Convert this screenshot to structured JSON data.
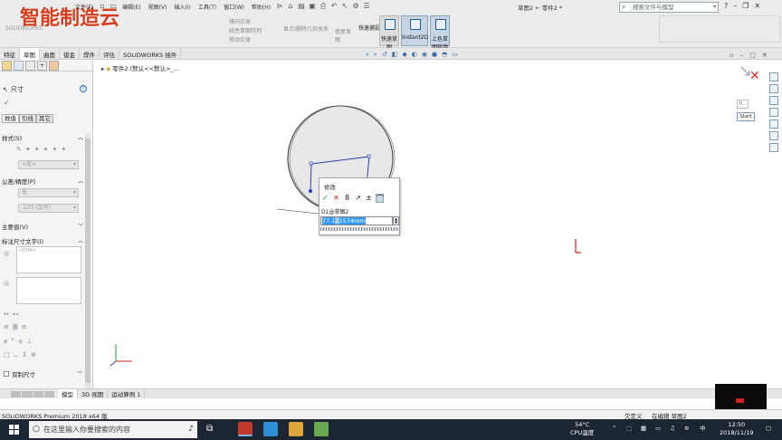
{
  "app": {
    "logo_text": "智能制造云",
    "logo_sub": "SOLIDWORKS",
    "doc_title": "草图2 ← 零件2 *",
    "search_placeholder": "搜索文件与模型"
  },
  "menu": [
    "文件(F)",
    "编辑(E)",
    "视图(V)",
    "插入(I)",
    "工具(T)",
    "窗口(W)",
    "帮助(H)"
  ],
  "ribbon": {
    "groups": [
      "镜向实体",
      "线性草图阵列",
      "移动实体",
      "显示/删除几何关系",
      "修复草图",
      "快速捕捉"
    ],
    "buttons": [
      {
        "label": "快速草图",
        "selected": false
      },
      {
        "label": "Instant2D",
        "selected": true
      },
      {
        "label": "上色草图轮廓",
        "selected": true
      }
    ]
  },
  "command_tabs": [
    "特征",
    "草图",
    "曲面",
    "钣金",
    "焊件",
    "评估",
    "SOLIDWORKS 插件"
  ],
  "active_command_tab": "草图",
  "property_manager": {
    "title": "尺寸",
    "subtabs": [
      "数值",
      "引线",
      "其它"
    ],
    "style_section": "样式(S)",
    "style_value": "<无>",
    "tolerance_section": "公差/精度(P)",
    "tolerance_value": "无",
    "precision_value": ".123 (文件)",
    "primary_section": "主要值(V)",
    "dim_text_section": "标注尺寸文字(I)",
    "dim_text_value": "<DIM>",
    "dual_dim": "双制尺寸"
  },
  "tree": {
    "part_label": "零件2 (默认<<默认>_..."
  },
  "modify_dialog": {
    "title": "修改",
    "dim_name": "D1@草图2",
    "value_prefix": "77.1",
    "value_selected": "2",
    "value_suffix": "1574mm"
  },
  "right_panel": {
    "start_label": "Start",
    "p_label": "P..."
  },
  "bottom_tabs": [
    "模型",
    "3D 视图",
    "运动算例 1"
  ],
  "active_bottom_tab": "模型",
  "status": {
    "left": "SOLIDWORKS Premium 2018 x64 版",
    "state1": "欠定义",
    "state2": "在编辑 草图2"
  },
  "taskbar": {
    "search_text": "在这里输入你要搜索的内容",
    "temp": "54°C",
    "temp_label": "CPU温度",
    "ime": "中",
    "time": "12:50",
    "date": "2018/11/19"
  },
  "colors": {
    "accent": "#1f5f9e",
    "logo": "#d63d1f",
    "taskbar": "#1c2633",
    "sketch_line": "#2a3fb0"
  }
}
